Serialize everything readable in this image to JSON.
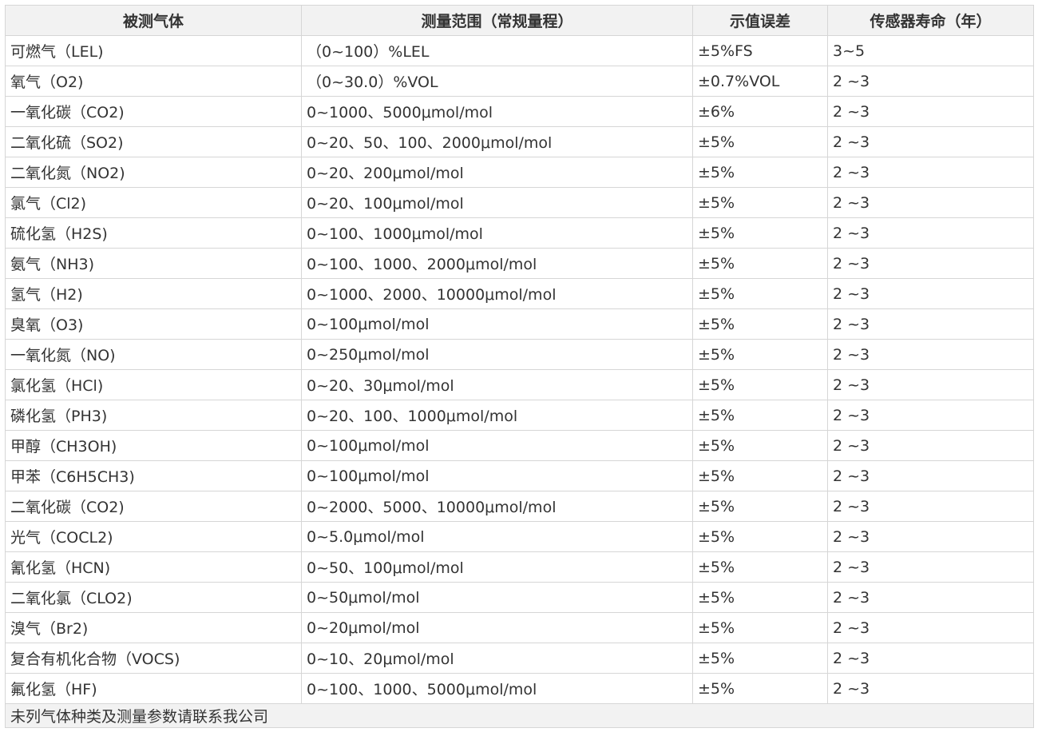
{
  "table": {
    "headers": [
      "被测气体",
      "测量范围（常规量程）",
      "示值误差",
      "传感器寿命（年）"
    ],
    "rows": [
      [
        "可燃气（LEL)",
        "（0~100）%LEL",
        "±5%FS",
        "3~5"
      ],
      [
        "氧气（O2)",
        "（0~30.0）%VOL",
        "±0.7%VOL",
        "2 ~3"
      ],
      [
        "一氧化碳（CO2)",
        "0~1000、5000μmol/mol",
        "±6%",
        "2 ~3"
      ],
      [
        "二氧化硫（SO2)",
        "0~20、50、100、2000μmol/mol",
        "±5%",
        "2 ~3"
      ],
      [
        "二氧化氮（NO2)",
        "0~20、200μmol/mol",
        "±5%",
        "2 ~3"
      ],
      [
        "氯气（Cl2)",
        "0~20、100μmol/mol",
        "±5%",
        "2 ~3"
      ],
      [
        "硫化氢（H2S)",
        "0~100、1000μmol/mol",
        "±5%",
        "2 ~3"
      ],
      [
        "氨气（NH3)",
        "0~100、1000、2000μmol/mol",
        "±5%",
        "2 ~3"
      ],
      [
        "氢气（H2)",
        "0~1000、2000、10000μmol/mol",
        "±5%",
        "2 ~3"
      ],
      [
        "臭氧（O3)",
        "0~100μmol/mol",
        "±5%",
        "2 ~3"
      ],
      [
        "一氧化氮（NO)",
        "0~250μmol/mol",
        "±5%",
        "2 ~3"
      ],
      [
        "氯化氢（HCl)",
        "0~20、30μmol/mol",
        "±5%",
        "2 ~3"
      ],
      [
        "磷化氢（PH3)",
        "0~20、100、1000μmol/mol",
        "±5%",
        "2 ~3"
      ],
      [
        "甲醇（CH3OH)",
        "0~100μmol/mol",
        "±5%",
        "2 ~3"
      ],
      [
        "甲苯（C6H5CH3)",
        "0~100μmol/mol",
        "±5%",
        "2 ~3"
      ],
      [
        "二氧化碳（CO2)",
        "0~2000、5000、10000μmol/mol",
        "±5%",
        "2 ~3"
      ],
      [
        "光气（COCL2)",
        "0~5.0μmol/mol",
        "±5%",
        "2 ~3"
      ],
      [
        "氰化氢（HCN)",
        "0~50、100μmol/mol",
        "±5%",
        "2 ~3"
      ],
      [
        "二氧化氯（CLO2)",
        "0~50μmol/mol",
        "±5%",
        "2 ~3"
      ],
      [
        "溴气（Br2)",
        "0~20μmol/mol",
        "±5%",
        "2 ~3"
      ],
      [
        "复合有机化合物（VOCS)",
        "0~10、20μmol/mol",
        "±5%",
        "2 ~3"
      ],
      [
        "氟化氢（HF)",
        "0~100、1000、5000μmol/mol",
        "±5%",
        "2 ~3"
      ]
    ],
    "footer": "未列气体种类及测量参数请联系我公司"
  }
}
